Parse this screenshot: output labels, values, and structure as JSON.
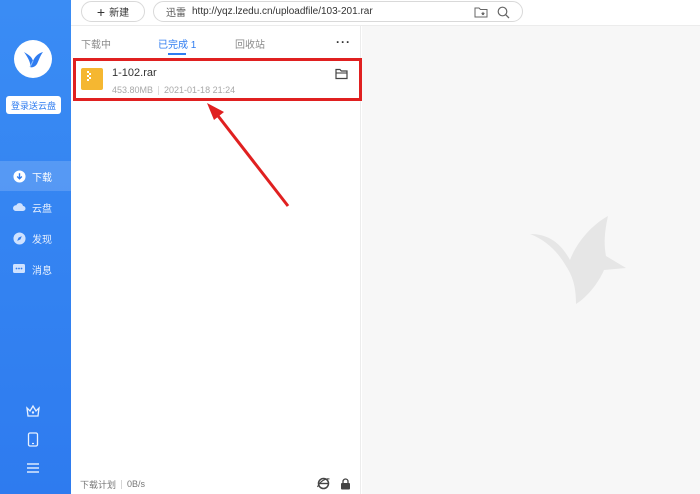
{
  "sidebar": {
    "login_label": "登录送云盘",
    "nav": [
      {
        "label": "下载",
        "icon": "download-icon",
        "active": true
      },
      {
        "label": "云盘",
        "icon": "cloud-icon",
        "active": false
      },
      {
        "label": "发现",
        "icon": "compass-icon",
        "active": false
      },
      {
        "label": "消息",
        "icon": "message-icon",
        "active": false
      }
    ],
    "bottom_icons": [
      "crown-icon",
      "phone-icon",
      "menu-icon"
    ]
  },
  "topbar": {
    "new_label": "新建",
    "url_prefix": "迅雷",
    "url_value": "http://yqz.lzedu.cn/uploadfile/103-201.rar"
  },
  "tabs": [
    {
      "label": "下载中"
    },
    {
      "label": "已完成 1",
      "active": true
    },
    {
      "label": "回收站"
    }
  ],
  "items": [
    {
      "name": "1-102.rar",
      "size": "453.80MB",
      "date": "2021-01-18 21:24"
    }
  ],
  "footer": {
    "plan_label": "下载计划",
    "speed": "0B/s"
  },
  "colors": {
    "sidebar": "#3a8cf4",
    "accent": "#2f7cf0",
    "file_icon": "#f5b731",
    "highlight": "#e02020"
  }
}
